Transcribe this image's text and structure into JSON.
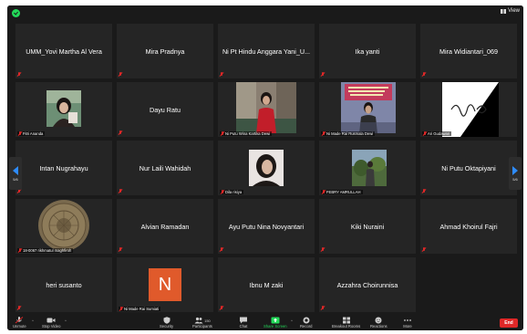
{
  "tiles": [
    {
      "type": "name",
      "name": "UMM_Yovi Martha Al Vera"
    },
    {
      "type": "name",
      "name": "Mira Pradnya"
    },
    {
      "type": "name",
      "name": "Ni Pt Hindu Anggara Yani_U..."
    },
    {
      "type": "name",
      "name": "Ika yanti"
    },
    {
      "type": "name",
      "name": "Mira Widiantari_069"
    },
    {
      "type": "video",
      "label": "Fitri Ananda"
    },
    {
      "type": "name",
      "name": "Dayu Ratu"
    },
    {
      "type": "video",
      "label": "Ni Putu Wina Kartika Dewi"
    },
    {
      "type": "video",
      "label": "Ni Made Rai Rusmala Dewi"
    },
    {
      "type": "video",
      "label": "Ari Gudawan"
    },
    {
      "type": "name",
      "name": "Intan Nugrahayu"
    },
    {
      "type": "name",
      "name": "Nur Laili Wahidah"
    },
    {
      "type": "video",
      "label": "Dila risiya"
    },
    {
      "type": "video",
      "label": "FEBRY AMRULLAH"
    },
    {
      "type": "name",
      "name": "Ni Putu Oktapiyani"
    },
    {
      "type": "video",
      "label": "18-0067 rikhmatul maghfiroh"
    },
    {
      "type": "name",
      "name": "Alvian Ramadan"
    },
    {
      "type": "name",
      "name": "Ayu Putu Nina Novyantari"
    },
    {
      "type": "name",
      "name": "Kiki Nuraini"
    },
    {
      "type": "name",
      "name": "Ahmad Khoirul Fajri"
    },
    {
      "type": "name",
      "name": "heri susanto"
    },
    {
      "type": "avatar",
      "initial": "N",
      "label": "Ni Made Rai Sumiati"
    },
    {
      "type": "name",
      "name": "Ibnu M zaki"
    },
    {
      "type": "name",
      "name": "Azzahra Choirunnisa"
    },
    {
      "type": "empty"
    }
  ],
  "topbar": {
    "view_label": "View"
  },
  "nav": {
    "left_page": "5/6",
    "right_page": "5/6"
  },
  "toolbar": {
    "unmute": "Unmute",
    "stop_video": "Stop Video",
    "security": "Security",
    "participants": "Participants",
    "participants_count": "150",
    "chat": "Chat",
    "share_screen": "Share Screen",
    "record": "Record",
    "breakout": "Breakout Rooms",
    "reactions": "Reactions",
    "more": "More",
    "end": "End"
  },
  "colors": {
    "end": "#e02828",
    "share": "#23d959",
    "avatar": "#e05a2b",
    "accent": "#2e8cff"
  }
}
